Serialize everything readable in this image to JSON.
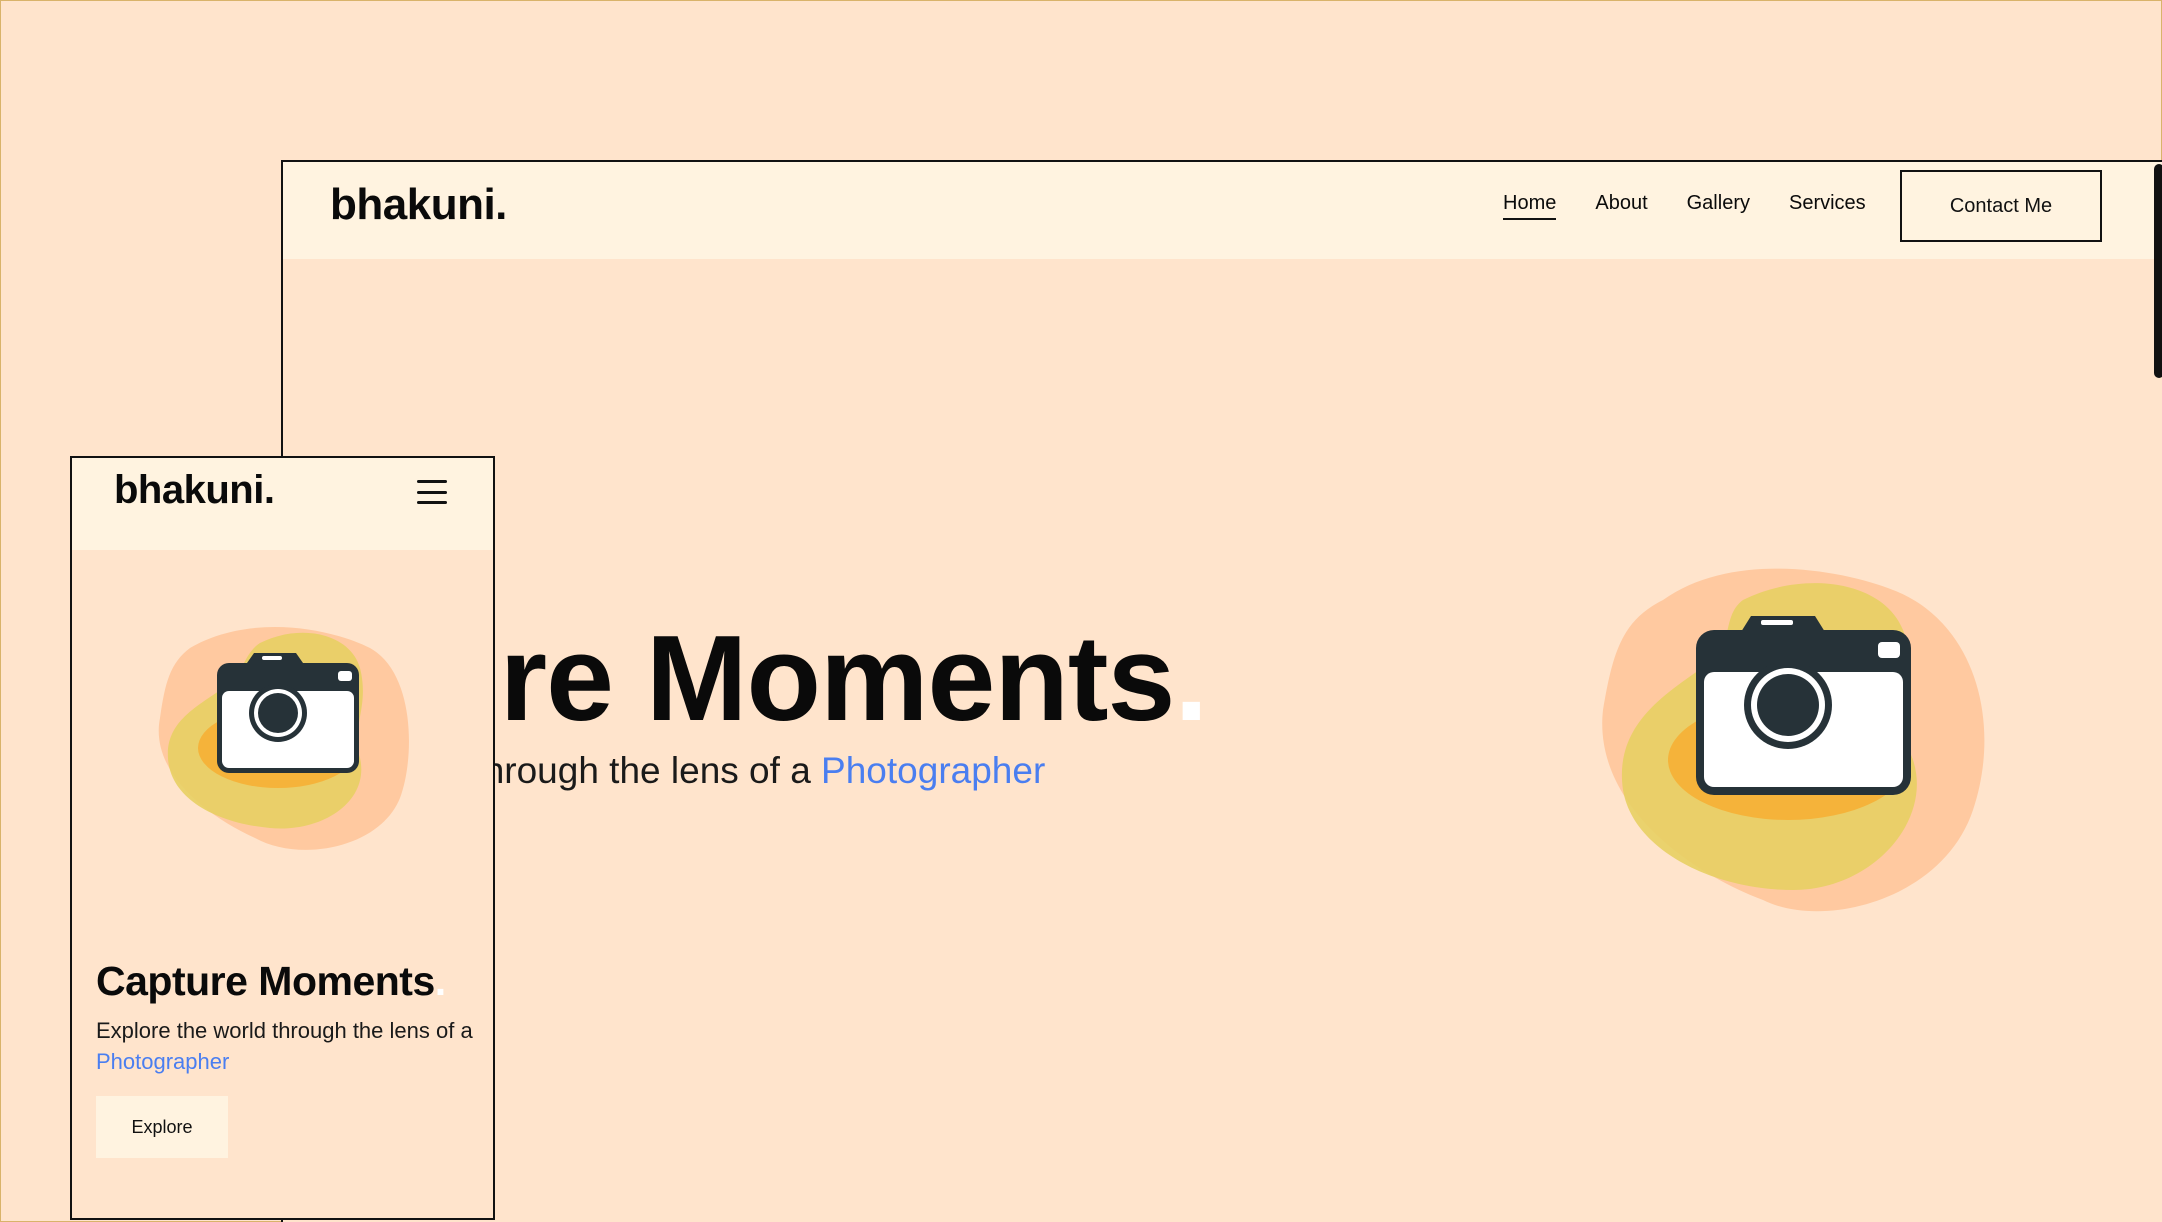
{
  "brand": {
    "logo_text": "bhakuni."
  },
  "desktop": {
    "nav": {
      "links": [
        "Home",
        "About",
        "Gallery",
        "Services"
      ],
      "active_link": "Home",
      "contact_button": "Contact Me"
    },
    "hero": {
      "title_visible": "pture Moments",
      "title_dot": ".",
      "subtitle_prefix": "the world through the lens of a",
      "subtitle_accent": "Photographer"
    },
    "illustration": "camera-icon"
  },
  "mobile": {
    "menu_icon": "hamburger-menu-icon",
    "hero": {
      "title": "Capture Moments",
      "title_dot": ".",
      "subtitle_prefix": "Explore the world through the lens of a",
      "subtitle_accent": "Photographer",
      "explore_button": "Explore"
    },
    "illustration": "camera-icon"
  },
  "colors": {
    "background": "#ffe4cc",
    "nav_background": "#fff3e0",
    "accent": "#4a7ef0",
    "text": "#0a0a0a",
    "blob_peach": "#ffc9a0",
    "blob_yellow": "#e8cf63",
    "blob_orange": "#f5b33a",
    "camera_dark": "#263238"
  }
}
